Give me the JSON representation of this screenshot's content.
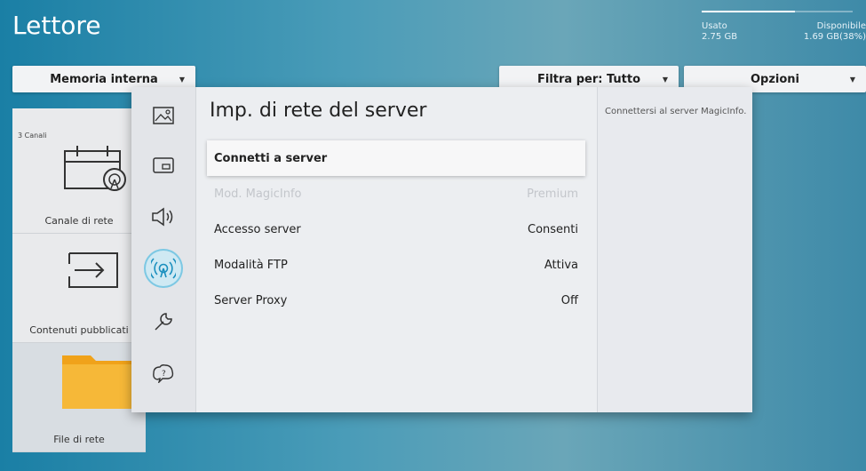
{
  "app": {
    "title": "Lettore"
  },
  "storage": {
    "used_label": "Usato",
    "used_value": "2.75 GB",
    "free_label": "Disponibile",
    "free_value": "1.69 GB(38%)"
  },
  "toolbar": {
    "memory_label": "Memoria interna",
    "filter_label": "Filtra per: Tutto",
    "options_label": "Opzioni"
  },
  "cards": [
    {
      "count": "3 Canali",
      "label": "Canale di rete"
    },
    {
      "label": "Contenuti pubblicati"
    },
    {
      "label": "File di rete"
    }
  ],
  "panel": {
    "title": "Imp. di rete del server",
    "rows": [
      {
        "label": "Connetti a server",
        "value": ""
      },
      {
        "label": "Mod. MagicInfo",
        "value": "Premium"
      },
      {
        "label": "Accesso server",
        "value": "Consenti"
      },
      {
        "label": "Modalità FTP",
        "value": "Attiva"
      },
      {
        "label": "Server Proxy",
        "value": "Off"
      }
    ],
    "help": "Connettersi al server MagicInfo."
  },
  "icons": [
    "picture-icon",
    "display-icon",
    "sound-icon",
    "network-icon",
    "support-wrench-icon",
    "help-icon"
  ],
  "colors": {
    "accent": "#2aa3d1",
    "panel": "#eceef1"
  }
}
